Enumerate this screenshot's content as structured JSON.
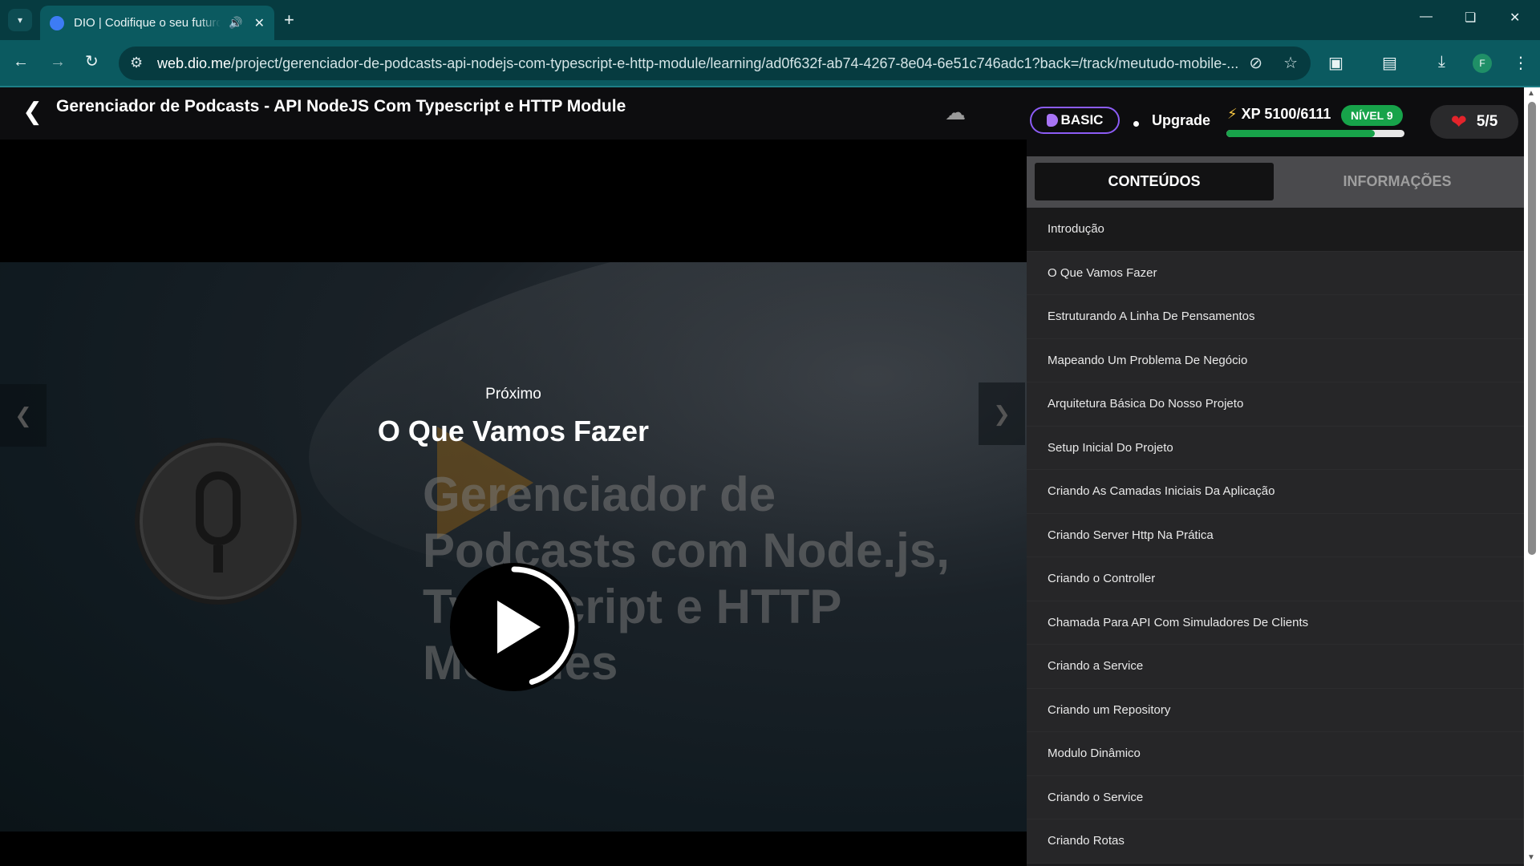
{
  "browser": {
    "tab_title": "DIO | Codifique o seu futuro",
    "url_host": "web.dio.me",
    "url_path": "/project/gerenciador-de-podcasts-api-nodejs-com-typescript-e-http-module/learning/ad0f632f-ab74-4267-8e04-6e51c746adc1?back=/track/meutudo-mobile-...",
    "profile_initial": "F",
    "icons": {
      "tab_search": "chevron-down-icon",
      "speaker": "speaker-icon",
      "tab_close": "close-icon",
      "new_tab": "plus-icon",
      "minimize": "minimize-icon",
      "restore": "restore-icon",
      "close_window": "close-icon",
      "back": "arrow-left-icon",
      "forward": "arrow-right-icon",
      "reload": "reload-icon",
      "site_info": "tune-icon",
      "eye_off": "eye-off-icon",
      "bookmark": "star-icon",
      "extensions": "puzzle-icon",
      "reading_mode": "book-icon",
      "downloads": "download-icon",
      "menu": "kebab-menu-icon"
    }
  },
  "header": {
    "title": "Gerenciador de Podcasts - API NodeJS Com Typescript e HTTP Module",
    "icons": {
      "back": "chevron-left-icon",
      "download": "cloud-download-icon"
    }
  },
  "video": {
    "background_title": "Gerenciador de Podcasts com Node.js, Typescript e HTTP Modules",
    "next_label": "Próximo",
    "next_title": "O Que Vamos Fazer",
    "countdown_progress": 0.45,
    "icons": {
      "play": "play-icon",
      "prev": "chevron-left-icon",
      "next": "chevron-right-icon"
    }
  },
  "status": {
    "plan": "BASIC",
    "upgrade": "Upgrade",
    "xp_label": "XP 5100/6111",
    "xp_progress": 0.835,
    "level": "NÍVEL 9",
    "lives": "5/5",
    "accent_purple": "#8c5cf5",
    "accent_green": "#18a34a",
    "heart_color": "#e3242b"
  },
  "tabs": {
    "contents": "CONTEÚDOS",
    "info": "INFORMAÇÕES",
    "active": "CONTEÚDOS"
  },
  "lessons": [
    "Introdução",
    "O Que Vamos Fazer",
    "Estruturando A Linha De Pensamentos",
    "Mapeando Um Problema De Negócio",
    "Arquitetura Básica Do Nosso Projeto",
    "Setup Inicial Do Projeto",
    "Criando As Camadas Iniciais Da Aplicação",
    "Criando Server Http Na Prática",
    "Criando o Controller",
    "Chamada Para API Com Simuladores De Clients",
    "Criando a Service",
    "Criando um Repository",
    "Modulo Dinâmico",
    "Criando o Service",
    "Criando Rotas"
  ],
  "active_lesson_index": 0
}
